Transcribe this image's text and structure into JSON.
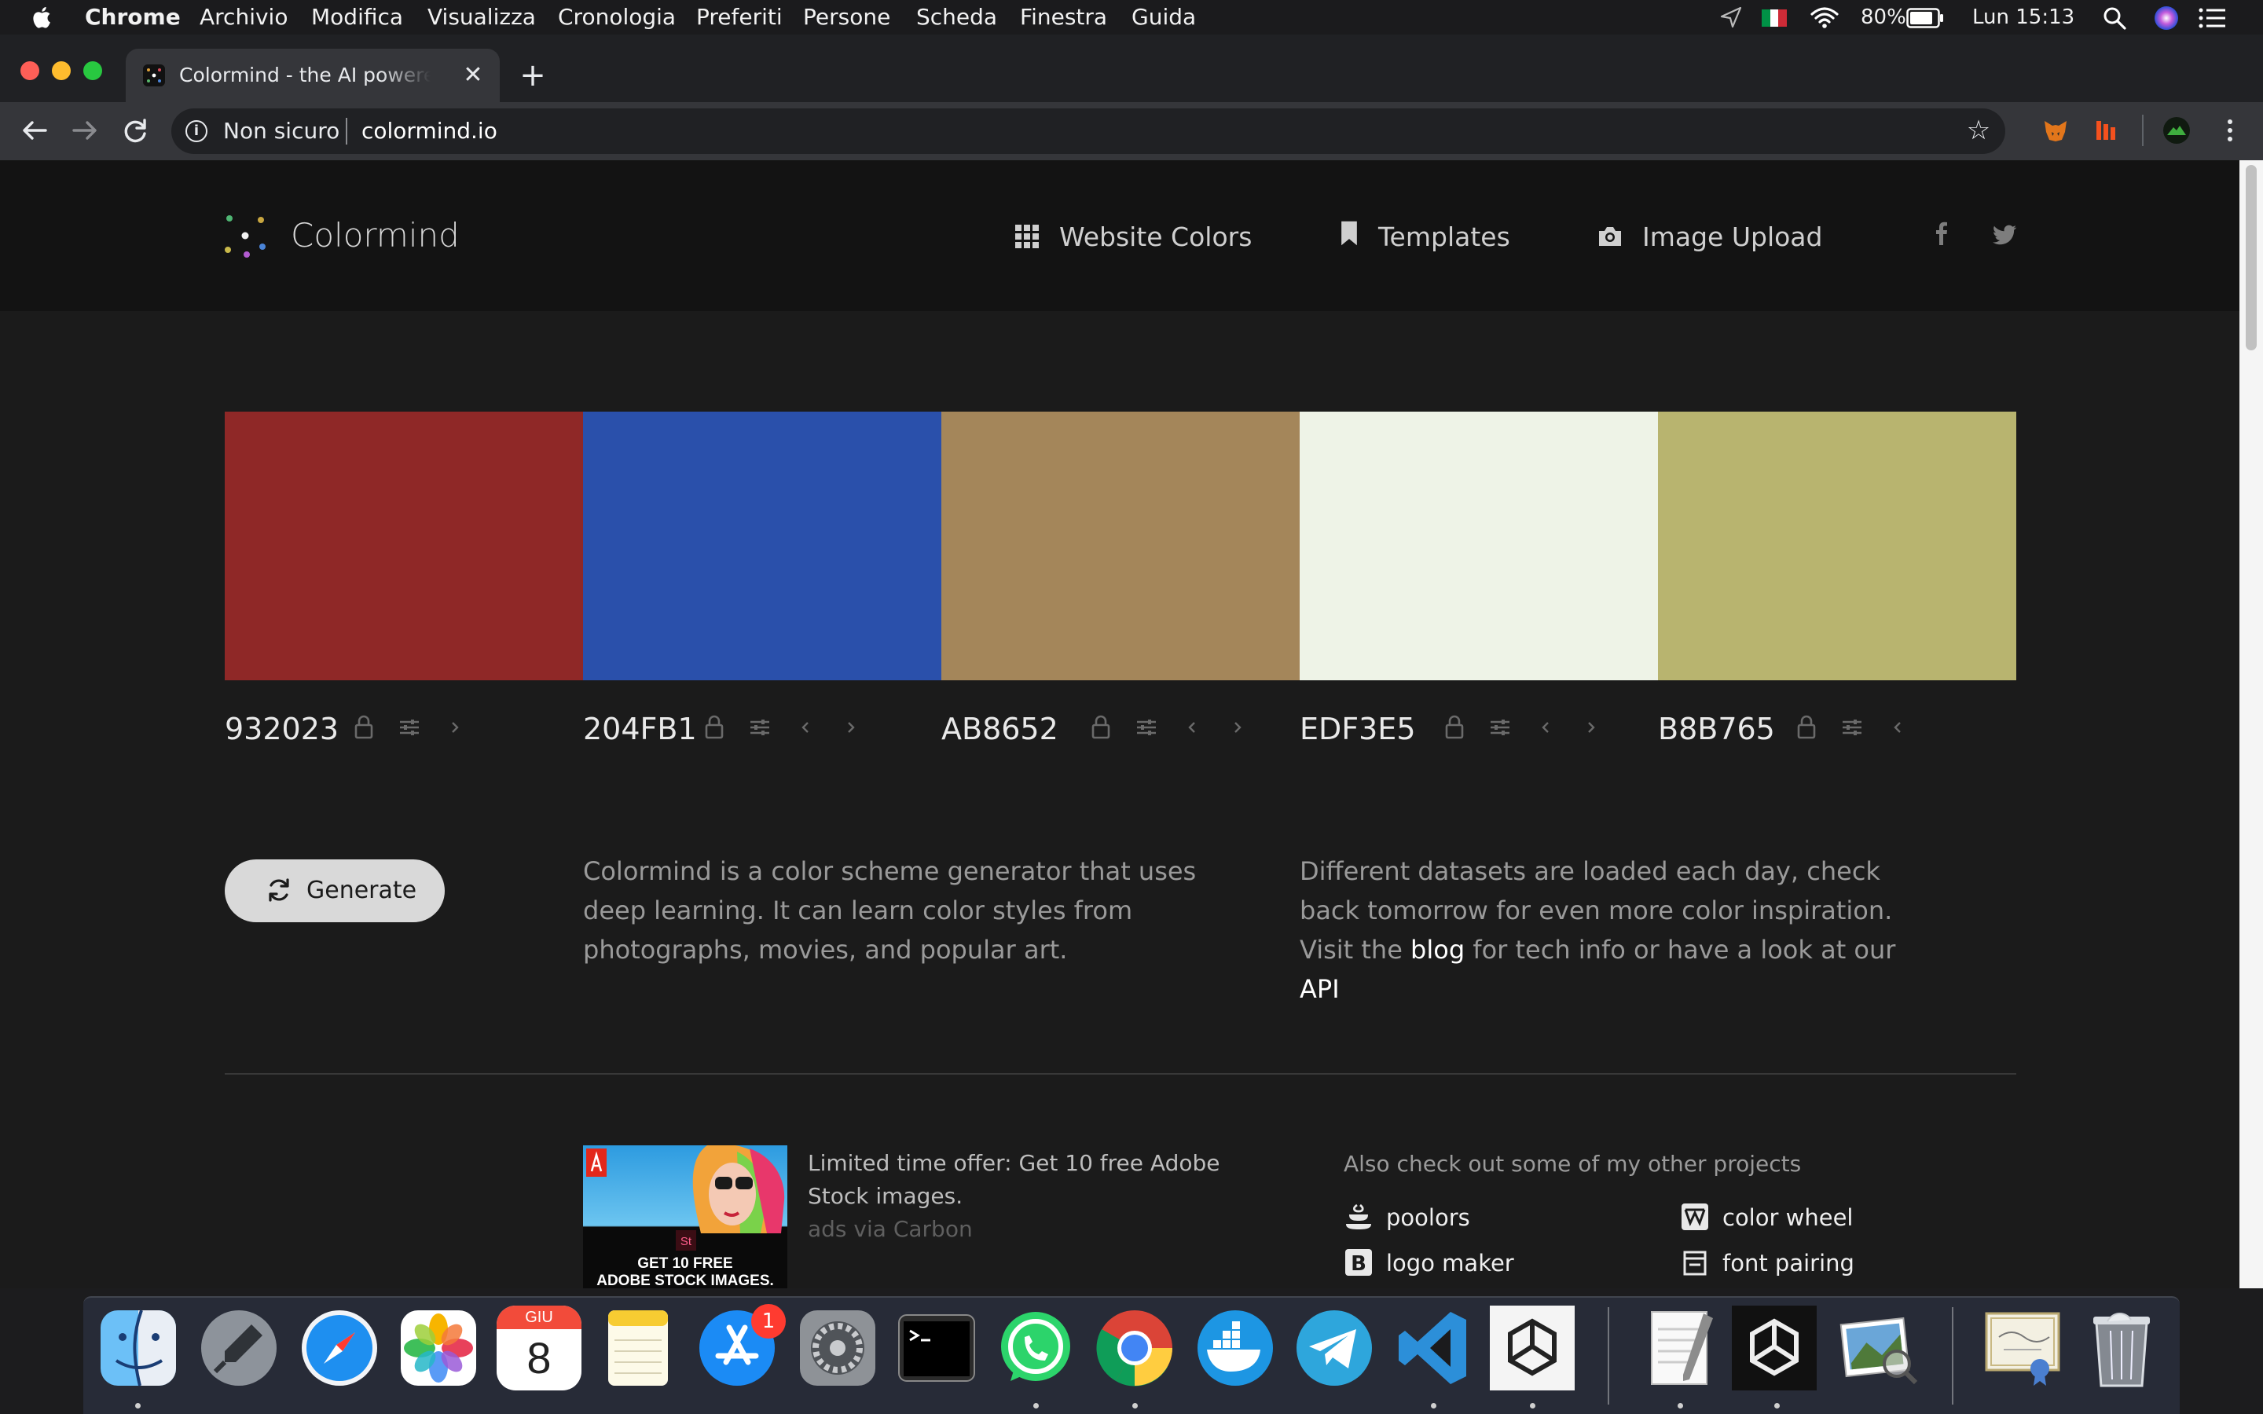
{
  "menubar": {
    "app_name": "Chrome",
    "menus": [
      "Archivio",
      "Modifica",
      "Visualizza",
      "Cronologia",
      "Preferiti",
      "Persone",
      "Scheda",
      "Finestra",
      "Guida"
    ],
    "battery": "80%",
    "clock": "Lun 15:13"
  },
  "browser": {
    "tab_title": "Colormind - the AI powered color palette generator",
    "security_label": "Non sicuro",
    "url": "colormind.io"
  },
  "site": {
    "logo_text": "Colormind",
    "nav": {
      "website_colors": "Website Colors",
      "templates": "Templates",
      "image_upload": "Image Upload"
    },
    "palette": [
      {
        "hex": "932023",
        "color": "#8f2827",
        "has_prev": false,
        "has_next": true
      },
      {
        "hex": "204FB1",
        "color": "#2a50ab",
        "has_prev": true,
        "has_next": true
      },
      {
        "hex": "AB8652",
        "color": "#a4865a",
        "has_prev": true,
        "has_next": true
      },
      {
        "hex": "EDF3E5",
        "color": "#eef3e7",
        "has_prev": true,
        "has_next": true
      },
      {
        "hex": "B8B765",
        "color": "#b8b46f",
        "has_prev": true,
        "has_next": false
      }
    ],
    "generate_label": "Generate",
    "description": "Colormind is a color scheme generator that uses deep learning. It can learn color styles from photographs, movies, and popular art.",
    "datasets_text": "Different datasets are loaded each day, check back tomorrow for even more color inspiration. Visit the",
    "blog_link": "blog",
    "datasets_mid": "for tech info or have a look at our",
    "api_link": "API",
    "ad": {
      "image_caption_line1": "GET 10 FREE",
      "image_caption_line2": "ADOBE STOCK IMAGES.",
      "text": "Limited time offer: Get 10 free Adobe Stock images.",
      "via": "ads via Carbon"
    },
    "other_projects_title": "Also check out some of my other projects",
    "projects": [
      {
        "label": "poolors",
        "icon": "poolors-icon"
      },
      {
        "label": "color wheel",
        "icon": "color-wheel-icon"
      },
      {
        "label": "logo maker",
        "icon": "logo-maker-icon"
      },
      {
        "label": "font pairing",
        "icon": "font-pairing-icon"
      }
    ]
  },
  "dock": {
    "calendar_month": "GIU",
    "calendar_day": "8",
    "appstore_badge": "1"
  }
}
